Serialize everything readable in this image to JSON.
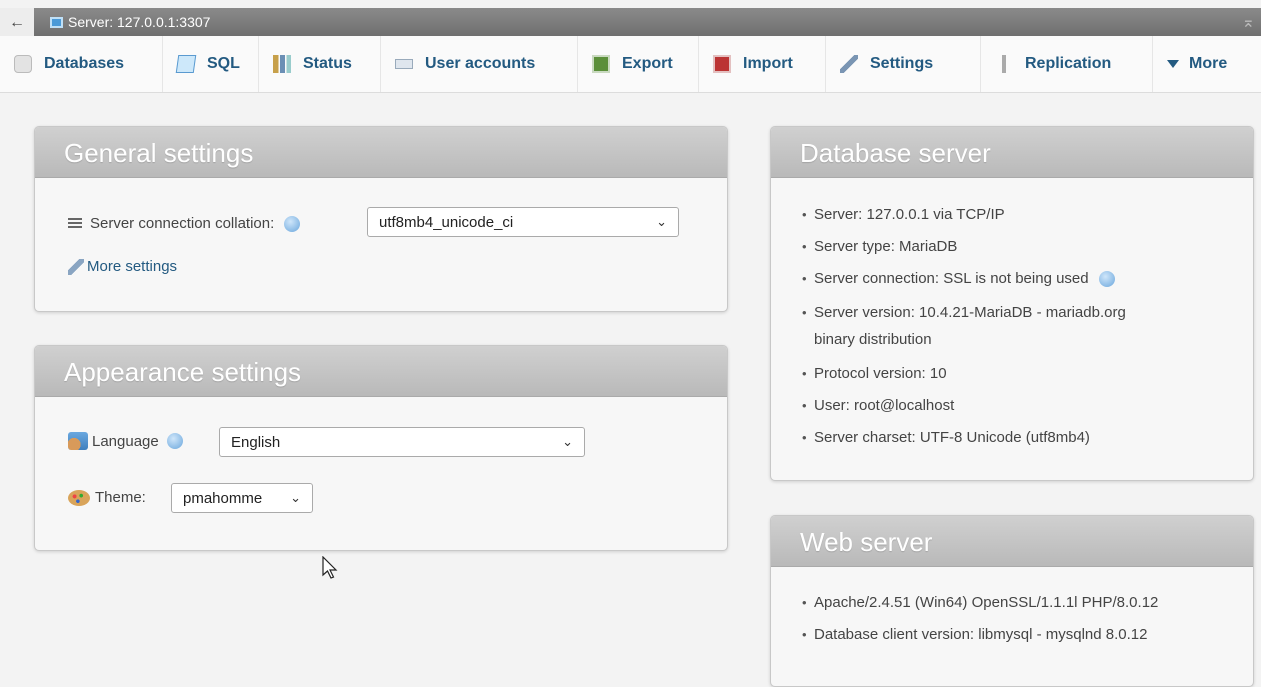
{
  "topbar": {
    "back": "←",
    "server_label": "Server: 127.0.0.1:3307",
    "collapse": "⌅"
  },
  "tabs": [
    {
      "label": "Databases",
      "icon": "database-icon"
    },
    {
      "label": "SQL",
      "icon": "sql-icon"
    },
    {
      "label": "Status",
      "icon": "status-icon"
    },
    {
      "label": "User accounts",
      "icon": "user-accounts-icon"
    },
    {
      "label": "Export",
      "icon": "export-icon"
    },
    {
      "label": "Import",
      "icon": "import-icon"
    },
    {
      "label": "Settings",
      "icon": "wrench-icon"
    },
    {
      "label": "Replication",
      "icon": "replication-icon"
    },
    {
      "label": "More",
      "icon": "triangle-down-icon"
    }
  ],
  "general": {
    "title": "General settings",
    "collation_label": "Server connection collation:",
    "collation_value": "utf8mb4_unicode_ci",
    "more_settings": "More settings"
  },
  "appearance": {
    "title": "Appearance settings",
    "language_label": "Language",
    "language_value": "English",
    "theme_label": "Theme:",
    "theme_value": "pmahomme"
  },
  "db_server": {
    "title": "Database server",
    "items": [
      "Server: 127.0.0.1 via TCP/IP",
      "Server type: MariaDB",
      "Server connection: SSL is not being used",
      "Server version: 10.4.21-MariaDB - mariadb.org",
      "binary distribution",
      "Protocol version: 10",
      "User: root@localhost",
      "Server charset: UTF-8 Unicode (utf8mb4)"
    ]
  },
  "web_server": {
    "title": "Web server",
    "items": [
      "Apache/2.4.51 (Win64) OpenSSL/1.1.1l PHP/8.0.12",
      "Database client version: libmysql - mysqlnd 8.0.12"
    ]
  },
  "colors": {
    "link": "#235a81",
    "panel_header": "#c4c4c4",
    "background": "#f3f3f3"
  }
}
